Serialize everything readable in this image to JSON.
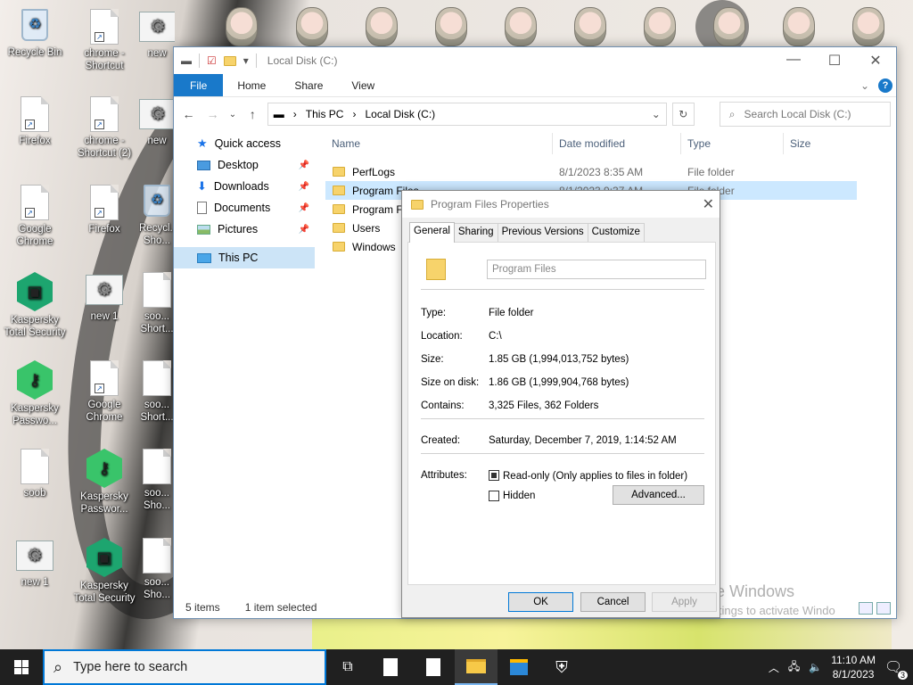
{
  "desktop": {
    "icons": [
      {
        "label": "Recycle Bin",
        "icon": "recycle-bin-icon"
      },
      {
        "label": "chrome - Shortcut",
        "icon": "document-icon"
      },
      {
        "label": "new",
        "icon": "gear-doc-icon"
      },
      {
        "label": "Firefox",
        "icon": "document-icon"
      },
      {
        "label": "chrome - Shortcut (2)",
        "icon": "document-icon"
      },
      {
        "label": "new",
        "icon": "gear-doc-icon"
      },
      {
        "label": "Google Chrome",
        "icon": "document-icon"
      },
      {
        "label": "Firefox",
        "icon": "document-icon"
      },
      {
        "label": "Recycl... Sho...",
        "icon": "recycle-bin-icon"
      },
      {
        "label": "Kaspersky Total Security",
        "icon": "kaspersky-icon"
      },
      {
        "label": "new 1",
        "icon": "gear-doc-icon"
      },
      {
        "label": "soo... Short...",
        "icon": "face-icon"
      },
      {
        "label": "Kaspersky Passwo...",
        "icon": "kaspersky-key-icon"
      },
      {
        "label": "Google Chrome",
        "icon": "document-icon"
      },
      {
        "label": "soo... Short...",
        "icon": "document-icon"
      },
      {
        "label": "soob",
        "icon": "document-icon"
      },
      {
        "label": "Kaspersky Passwor...",
        "icon": "kaspersky-key-icon"
      },
      {
        "label": "soo... Sho...",
        "icon": "face-icon"
      },
      {
        "label": "new 1",
        "icon": "gear-doc-icon"
      },
      {
        "label": "Kaspersky Total Security",
        "icon": "kaspersky-icon"
      },
      {
        "label": "soo... Sho...",
        "icon": "face-icon"
      }
    ]
  },
  "explorer": {
    "title": "Local Disk (C:)",
    "ribbon": {
      "file": "File",
      "home": "Home",
      "share": "Share",
      "view": "View"
    },
    "address": {
      "this_pc": "This PC",
      "location": "Local Disk (C:)"
    },
    "search_placeholder": "Search Local Disk (C:)",
    "nav": {
      "quick_access": "Quick access",
      "desktop": "Desktop",
      "downloads": "Downloads",
      "documents": "Documents",
      "pictures": "Pictures",
      "this_pc": "This PC"
    },
    "columns": {
      "name": "Name",
      "date": "Date modified",
      "type": "Type",
      "size": "Size"
    },
    "files": [
      {
        "name": "PerfLogs",
        "date": "8/1/2023 8:35 AM",
        "type": "File folder"
      },
      {
        "name": "Program Files",
        "date": "8/1/2023 9:37 AM",
        "type": "File folder"
      },
      {
        "name": "Program Fi",
        "date": "",
        "type": "der"
      },
      {
        "name": "Users",
        "date": "",
        "type": "der"
      },
      {
        "name": "Windows",
        "date": "",
        "type": "der"
      }
    ],
    "status": {
      "items": "5 items",
      "selected": "1 item selected"
    },
    "watermark": {
      "line1": "Activate Windows",
      "line2": "Go to Settings to activate Windo"
    }
  },
  "dialog": {
    "title": "Program Files Properties",
    "tabs": [
      "General",
      "Sharing",
      "Previous Versions",
      "Customize"
    ],
    "name_value": "Program Files",
    "props": {
      "type_k": "Type:",
      "type_v": "File folder",
      "location_k": "Location:",
      "location_v": "C:\\",
      "size_k": "Size:",
      "size_v": "1.85 GB (1,994,013,752 bytes)",
      "sizeondisk_k": "Size on disk:",
      "sizeondisk_v": "1.86 GB (1,999,904,768 bytes)",
      "contains_k": "Contains:",
      "contains_v": "3,325 Files, 362 Folders",
      "created_k": "Created:",
      "created_v": "Saturday, December 7, 2019, 1:14:52 AM",
      "attributes_k": "Attributes:"
    },
    "readonly_label": "Read-only (Only applies to files in folder)",
    "hidden_label": "Hidden",
    "advanced": "Advanced...",
    "ok": "OK",
    "cancel": "Cancel",
    "apply": "Apply"
  },
  "taskbar": {
    "search_placeholder": "Type here to search",
    "time": "11:10 AM",
    "date": "8/1/2023",
    "notifications": "3"
  }
}
